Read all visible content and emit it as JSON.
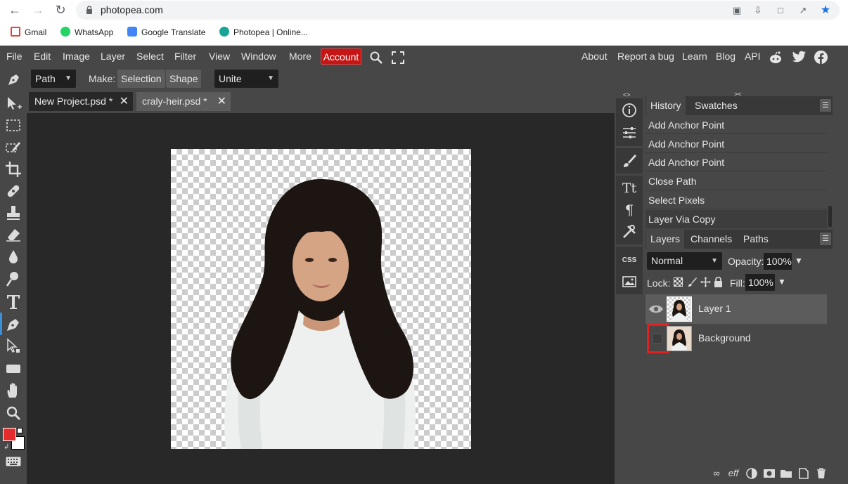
{
  "browser": {
    "url": "photopea.com",
    "bookmarks": [
      {
        "label": "Gmail",
        "icon": "gmail-icon",
        "color": "#ea4335"
      },
      {
        "label": "WhatsApp",
        "icon": "whatsapp-icon",
        "color": "#25d366"
      },
      {
        "label": "Google Translate",
        "icon": "google-translate-icon",
        "color": "#4285f4"
      },
      {
        "label": "Photopea | Online...",
        "icon": "photopea-icon",
        "color": "#18a497"
      }
    ]
  },
  "menubar": {
    "items": [
      "File",
      "Edit",
      "Image",
      "Layer",
      "Select",
      "Filter",
      "View",
      "Window",
      "More"
    ],
    "account": "Account",
    "right_items": [
      "About",
      "Report a bug",
      "Learn",
      "Blog",
      "API"
    ],
    "accent_color": "#c51515"
  },
  "options": {
    "mode": "Path",
    "make_label": "Make:",
    "selection": "Selection",
    "shape": "Shape",
    "combine": "Unite"
  },
  "documents": {
    "tabs": [
      "New Project.psd *",
      "craly-heir.psd *"
    ]
  },
  "history_panel": {
    "tabs": [
      "History",
      "Swatches"
    ],
    "rows": [
      "Add Anchor Point",
      "Add Anchor Point",
      "Add Anchor Point",
      "Close Path",
      "Select Pixels",
      "Layer Via Copy"
    ]
  },
  "layers_panel": {
    "tabs": [
      "Layers",
      "Channels",
      "Paths"
    ],
    "blend_mode": "Normal",
    "opacity_label": "Opacity:",
    "opacity_value": "100%",
    "lock_label": "Lock:",
    "fill_label": "Fill:",
    "fill_value": "100%",
    "layers": [
      {
        "name": "Layer 1",
        "visible": true,
        "selected": true
      },
      {
        "name": "Background",
        "visible": false,
        "selected": false
      }
    ]
  },
  "colors": {
    "foreground": "#e52b2b",
    "background": "#ffffff"
  }
}
